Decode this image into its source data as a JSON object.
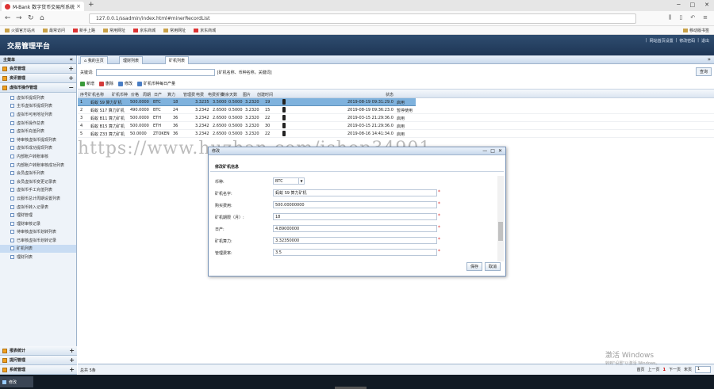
{
  "browser": {
    "tab_title": "M-Bank 数字货币交易所系统",
    "tab_close": "×",
    "new_tab": "+",
    "url": "127.0.0.1/ssadmin/index.html#minerRecordList",
    "window_controls": [
      "─",
      "□",
      "✕"
    ],
    "bookmarks": [
      "火狐官方站点",
      "最常访问",
      "新手上路",
      "常用网址",
      "京东商城",
      "常用网址",
      "京东商城"
    ],
    "mobile_bookmarks": "移动版书签"
  },
  "header": {
    "title": "交易管理平台",
    "links": [
      "网站首页设置",
      "修改密码",
      "退出"
    ],
    "separator": "|"
  },
  "sidebar": {
    "title": "主菜单",
    "collapse": "«",
    "groups_top": [
      {
        "label": "会员管理",
        "toggle": "+"
      },
      {
        "label": "资讯管理",
        "toggle": "+"
      },
      {
        "label": "虚拟币操作管理",
        "toggle": "−"
      }
    ],
    "items": [
      "虚拟币提现列表",
      "主币虚拟币提现列表",
      "虚拟币可用地址列表",
      "虚拟币操作总表",
      "虚拟币充值列表",
      "待审核虚拟币提现列表",
      "虚拟币成功提现列表",
      "内部账户转账审核",
      "内部账户转账审核成功列表",
      "会员虚拟币列表",
      "会员虚拟币变更记录表",
      "虚拟币手工充值列表",
      "云服币总计周期设置列表",
      "虚拟币转入记录表",
      "理财管理",
      "理财审核记录",
      "待审核虚拟币划转列表",
      "已审核虚拟币划转记录",
      "矿机列表",
      "理财列表"
    ],
    "active_index": 18,
    "groups_bottom": [
      {
        "label": "报表统计",
        "toggle": "+"
      },
      {
        "label": "提问管理",
        "toggle": "+"
      },
      {
        "label": "系统管理",
        "toggle": "+"
      }
    ]
  },
  "page_tabs": [
    "我的主页",
    "理财列表",
    "矿机列表"
  ],
  "page_tabs_more": "»",
  "search": {
    "label": "关键词:",
    "hint": "[矿机名称、币种名称，关键词]",
    "button": "查询"
  },
  "toolbar": [
    "新增",
    "删除",
    "修改",
    "矿机币种每日产量"
  ],
  "toolbar_colors": [
    "#3a9a3a",
    "#d33b3b",
    "#4a7ec4",
    "#4a7ec4"
  ],
  "table": {
    "headers": [
      "序号",
      "矿机名称",
      "矿机币种",
      "价格",
      "周期",
      "日产",
      "算力",
      "管理费",
      "电费",
      "电费折扣",
      "剩余天数",
      "图片",
      "创建时间",
      "状态"
    ],
    "rows": [
      [
        "1",
        "蚂蚁 S9 算力矿机",
        "500.0000",
        "BTC",
        "18",
        "3.3235",
        "3.5000",
        "0.5000",
        "3.2320",
        "19",
        "2019-08-19 09:31:29.0",
        "启用"
      ],
      [
        "2",
        "蚂蚁 S17 算力矿机",
        "490.0000",
        "BTC",
        "24",
        "3.2342",
        "2.6500",
        "0.5000",
        "3.2320",
        "15",
        "2019-08-19 09:36:23.0",
        "暂停使用"
      ],
      [
        "3",
        "蚂蚁 B11 算力矿机",
        "500.0000",
        "ETH",
        "36",
        "3.2342",
        "2.6500",
        "0.5000",
        "3.2320",
        "22",
        "2019-03-15 21:29:36.0",
        "启用"
      ],
      [
        "4",
        "蚂蚁 B15 算力矿机",
        "500.0000",
        "ETH",
        "36",
        "3.2342",
        "2.6500",
        "0.5000",
        "3.2320",
        "30",
        "2019-03-15 21:29:36.0",
        "启用"
      ],
      [
        "5",
        "蚂蚁 Z33 算力矿机",
        "50.0000",
        "ZTOKEN",
        "36",
        "3.2342",
        "2.6500",
        "0.5000",
        "3.2320",
        "22",
        "2019-08-16 14:41:34.0",
        "启用"
      ]
    ],
    "selected_row": 0
  },
  "watermark": "https://www.huzhan.com/ishop34901",
  "footer": {
    "total": "总共 5条",
    "first": "首页",
    "prev": "上一页",
    "current": "1",
    "next": "下一页",
    "last": "末页",
    "jump_value": "1"
  },
  "activate": {
    "line1": "激活 Windows",
    "line2": "转到\"设置\"以激活 Windows。"
  },
  "dialog": {
    "title": "修改",
    "controls": [
      "—",
      "□",
      "✕"
    ],
    "subtitle": "修改矿机信息",
    "fields": [
      {
        "label": "币种:",
        "value": "BTC",
        "select": true
      },
      {
        "label": "矿机名字:",
        "value": "蚂蚁 S9 算力矿机"
      },
      {
        "label": "购买费用:",
        "value": "500.00000000"
      },
      {
        "label": "矿机期限（月）:",
        "value": "18"
      },
      {
        "label": "日产:",
        "value": "4.89000000"
      },
      {
        "label": "矿机算力:",
        "value": "3.32350000"
      },
      {
        "label": "管理费率:",
        "value": "3.5"
      }
    ],
    "required_mark": "*",
    "save": "保存",
    "cancel": "取消"
  },
  "taskbar": {
    "item": "修改"
  }
}
